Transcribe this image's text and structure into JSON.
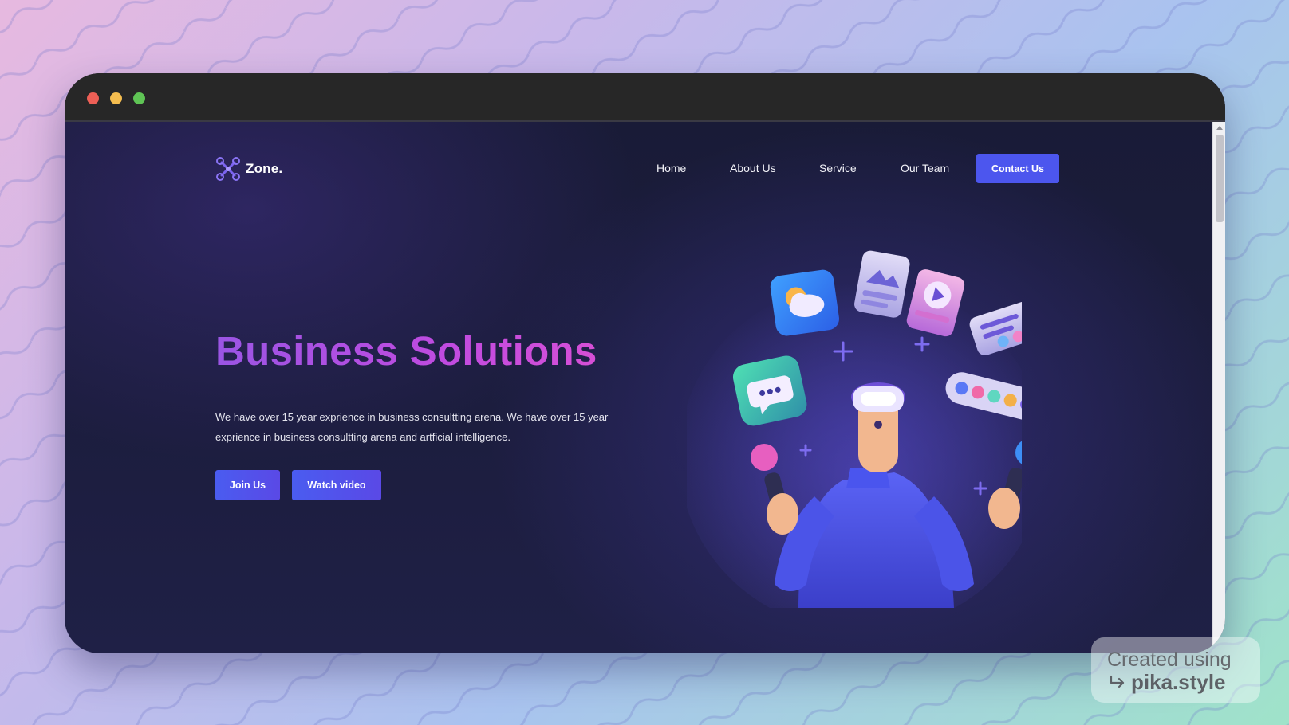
{
  "brand": {
    "name": "Zone."
  },
  "nav": {
    "items": [
      {
        "label": "Home"
      },
      {
        "label": "About Us"
      },
      {
        "label": "Service"
      },
      {
        "label": "Our Team"
      }
    ],
    "cta_label": "Contact Us"
  },
  "hero": {
    "title": "Business Solutions",
    "description": "We have over 15 year exprience in business consultting arena. We have over 15 year exprience in business consultting arena and artficial intelligence.",
    "primary_button": "Join Us",
    "secondary_button": "Watch video"
  },
  "watermark": {
    "line1": "Created using",
    "line2": "pika.style"
  },
  "colors": {
    "accent": "#4c56ee",
    "title_gradient_start": "#9a55e4",
    "title_gradient_end": "#d64fd6",
    "page_background": "#1b1d3c"
  },
  "icons": [
    "drone-logo-icon",
    "vr-character-illustration",
    "scroll-up-arrow-icon",
    "pika-arrow-icon"
  ]
}
